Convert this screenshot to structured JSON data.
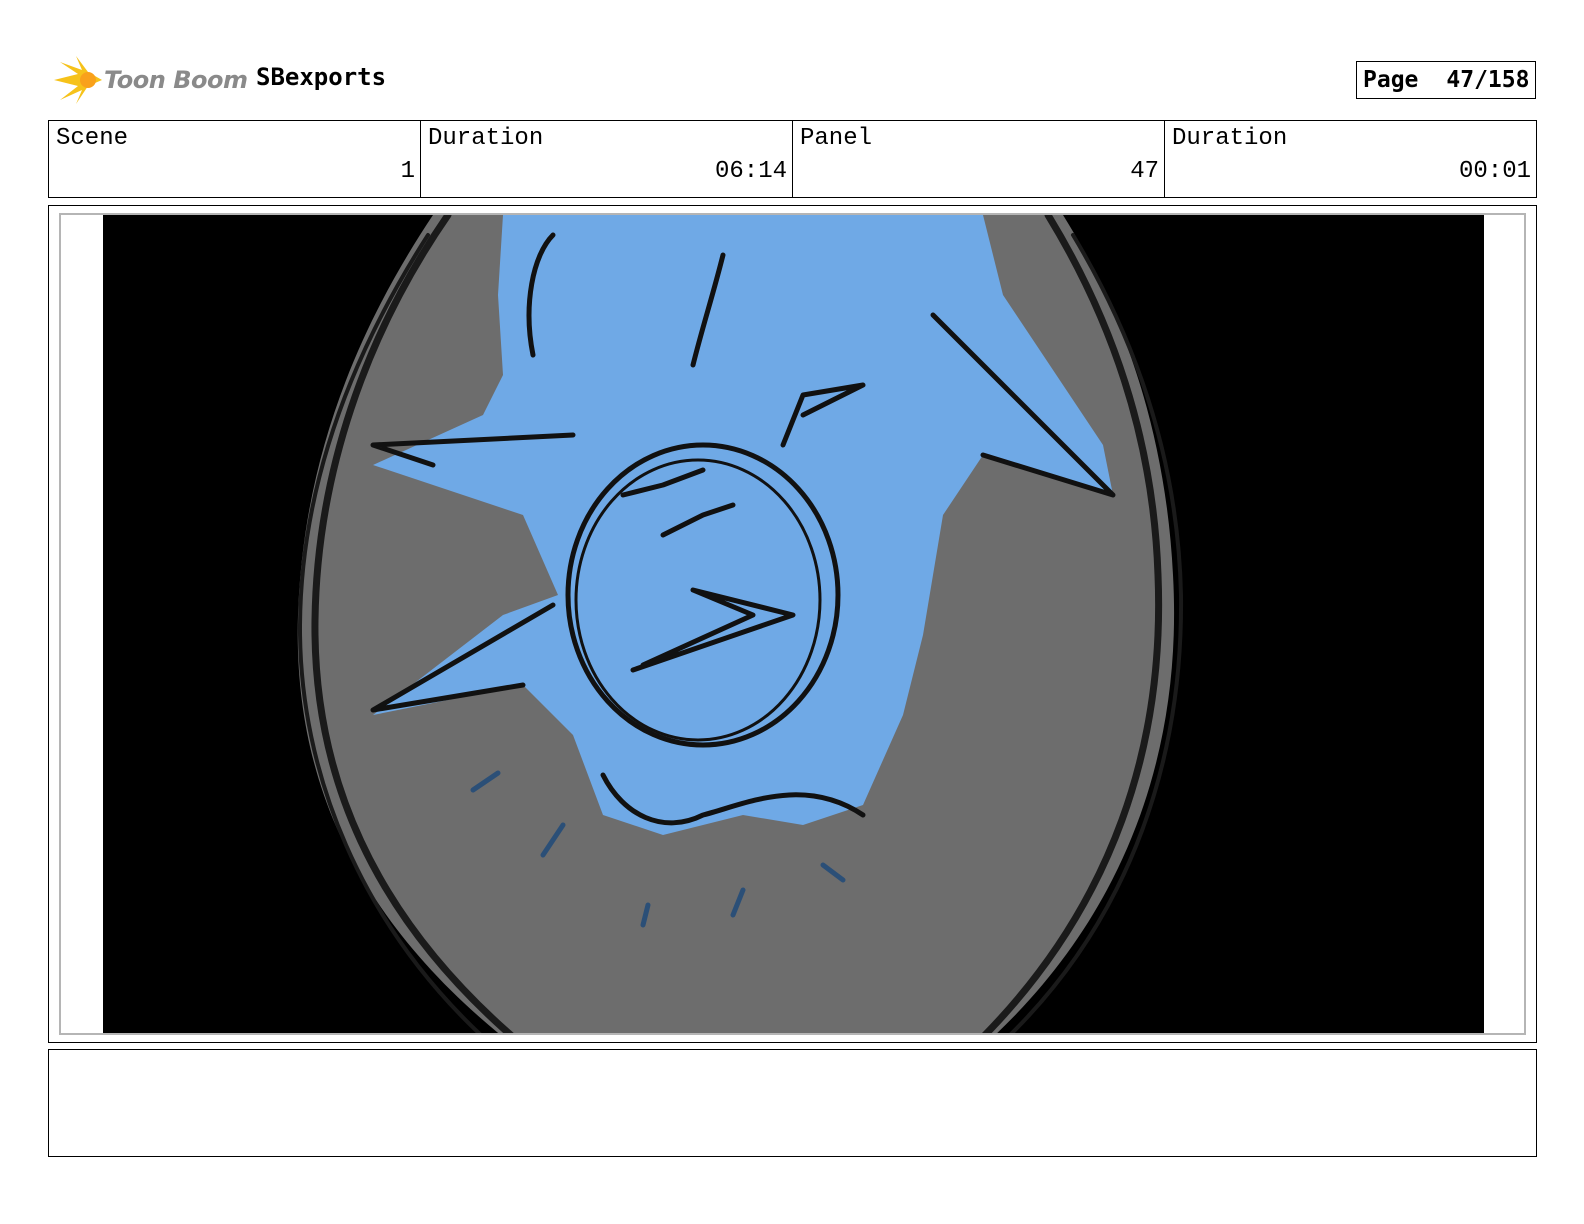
{
  "header": {
    "logo_text": "Toon Boom",
    "project": "SBexports",
    "page_label": "Page",
    "page_value": "47/158"
  },
  "info": {
    "scene_label": "Scene",
    "scene_value": "1",
    "scene_duration_label": "Duration",
    "scene_duration_value": "06:14",
    "panel_label": "Panel",
    "panel_value": "47",
    "panel_duration_label": "Duration",
    "panel_duration_value": "00:01"
  },
  "colors": {
    "background": "#000000",
    "mirror": "#6d6d6d",
    "character": "#6fa9e6",
    "lines": "#111111",
    "logo_flare": "#f6c21a"
  }
}
